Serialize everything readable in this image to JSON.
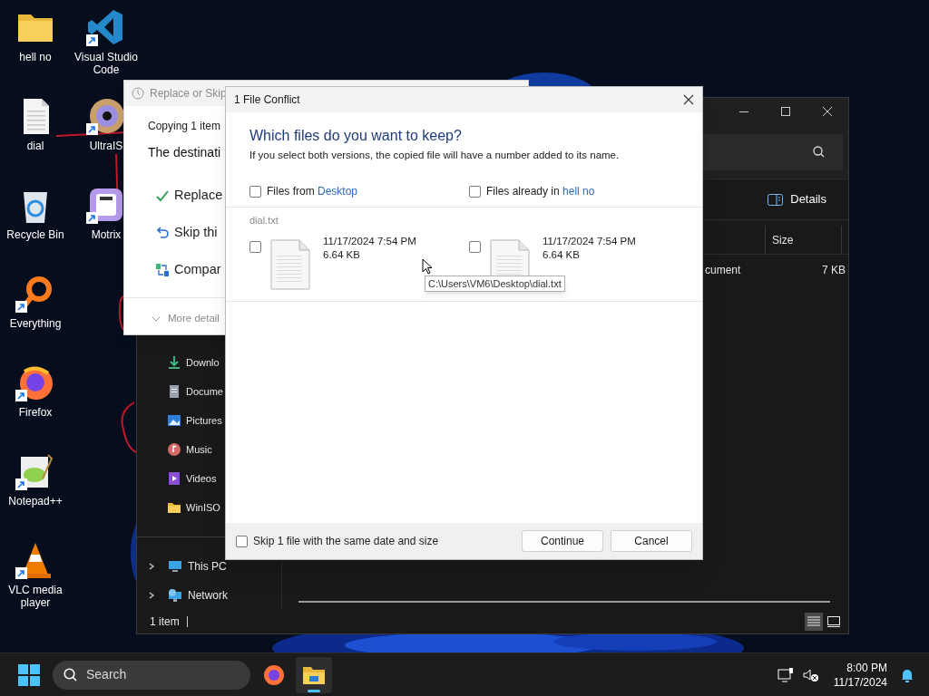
{
  "desktop_icon_columns": [
    [
      {
        "label": "hell no",
        "kind": "folder",
        "shortcut": false
      },
      {
        "label": "dial",
        "kind": "text-file",
        "shortcut": false
      },
      {
        "label": "Recycle Bin",
        "kind": "recycle",
        "shortcut": false
      },
      {
        "label": "Everything",
        "kind": "magnifier",
        "shortcut": true
      },
      {
        "label": "Firefox",
        "kind": "firefox",
        "shortcut": true
      },
      {
        "label": "Notepad++",
        "kind": "notepad",
        "shortcut": true
      },
      {
        "label": "VLC media player",
        "kind": "cone",
        "shortcut": true
      }
    ],
    [
      {
        "label": "Visual Studio Code",
        "kind": "code",
        "shortcut": true
      },
      {
        "label": "UltraIS",
        "kind": "disc",
        "shortcut": true
      },
      {
        "label": "Motrix",
        "kind": "motrix",
        "shortcut": true
      }
    ]
  ],
  "explorer": {
    "details_button": "Details",
    "columns": [
      "Size"
    ],
    "rows": [
      {
        "type": "cument",
        "size": "7 KB"
      }
    ],
    "nav_items": [
      {
        "label": "Downlo",
        "kind": "download"
      },
      {
        "label": "Docume",
        "kind": "document"
      },
      {
        "label": "Pictures",
        "kind": "pictures"
      },
      {
        "label": "Music",
        "kind": "music"
      },
      {
        "label": "Videos",
        "kind": "videos"
      },
      {
        "label": "WinISO",
        "kind": "folder"
      }
    ],
    "nav_roots": [
      {
        "label": "This PC",
        "kind": "pc",
        "expanded": false
      },
      {
        "label": "Network",
        "kind": "network",
        "expanded": false
      }
    ],
    "status": "1 item",
    "view_modes": [
      {
        "kind": "details",
        "selected": true
      },
      {
        "kind": "tiles",
        "selected": false
      }
    ]
  },
  "replace_dialog": {
    "title": "Replace or Skip",
    "copying": "Copying 1 item",
    "message": "The destinati",
    "options": [
      {
        "label": "Replace",
        "kind": "check"
      },
      {
        "label": "Skip thi",
        "kind": "skip"
      },
      {
        "label": "Compar",
        "kind": "compare"
      }
    ],
    "more_details": "More detail"
  },
  "conflict_dialog": {
    "title": "1 File Conflict",
    "heading": "Which files do you want to keep?",
    "subtext": "If you select both versions, the copied file will have a number added to its name.",
    "sides": [
      {
        "label": "Files from",
        "location": "Desktop",
        "checked": false
      },
      {
        "label": "Files already in",
        "location": "hell no",
        "checked": false
      }
    ],
    "file_name": "dial.txt",
    "versions": [
      {
        "date": "11/17/2024 7:54 PM",
        "size": "6.64 KB",
        "checked": false
      },
      {
        "date": "11/17/2024 7:54 PM",
        "size": "6.64 KB",
        "checked": false
      }
    ],
    "tooltip": "C:\\Users\\VM6\\Desktop\\dial.txt",
    "skip_same": {
      "label": "Skip 1 file with the same date and size",
      "checked": false
    },
    "buttons": [
      "Continue",
      "Cancel"
    ]
  },
  "taskbar": {
    "search_placeholder": "Search",
    "apps": [
      {
        "kind": "firefox",
        "selected": false
      },
      {
        "kind": "explorer",
        "selected": true
      }
    ],
    "time": "8:00 PM",
    "date": "11/17/2024"
  }
}
